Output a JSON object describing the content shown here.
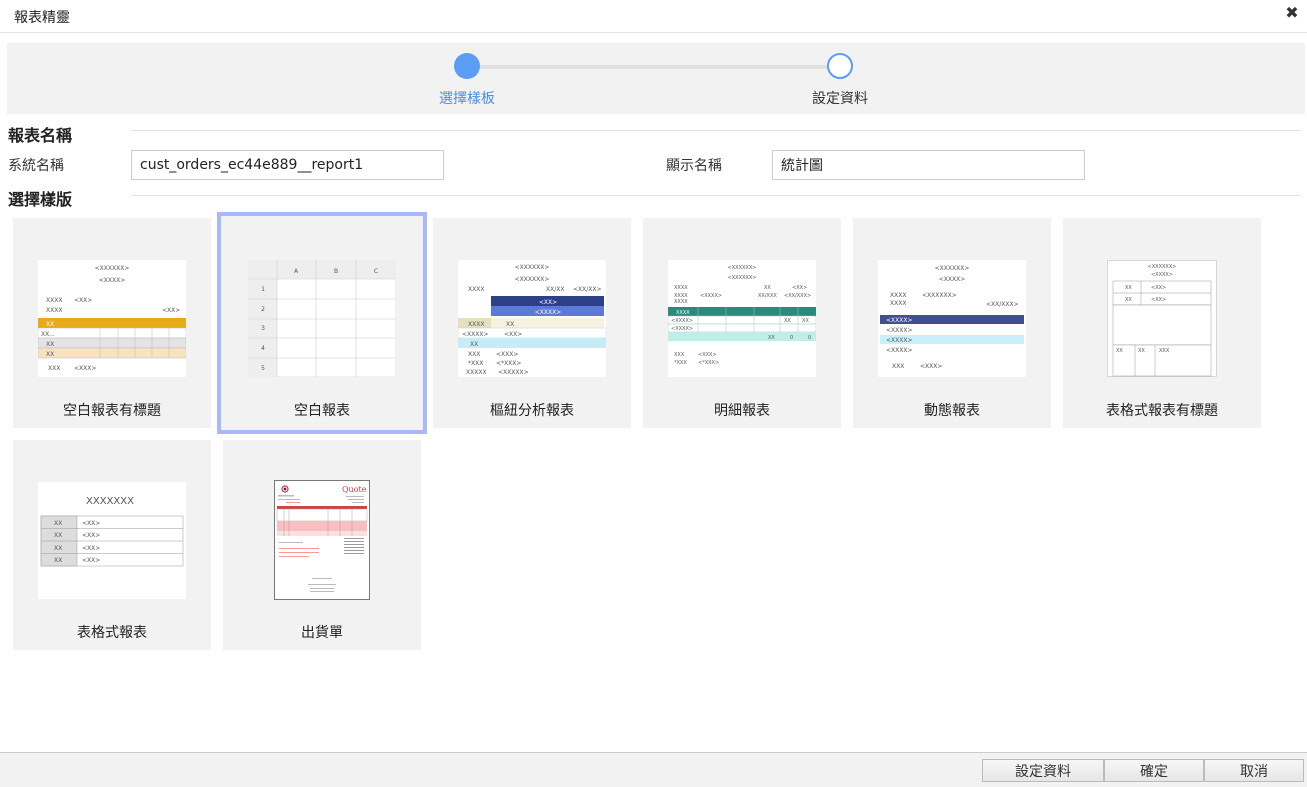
{
  "window": {
    "title": "報表精靈"
  },
  "steps": [
    {
      "label": "選擇樣板",
      "active": true
    },
    {
      "label": "設定資料",
      "active": false
    }
  ],
  "report_name": {
    "section_title": "報表名稱",
    "system_name_label": "系統名稱",
    "system_name_value": "cust_orders_ec44e889__report1",
    "display_name_label": "顯示名稱",
    "display_name_value": "統計圖"
  },
  "template_section": {
    "section_title": "選擇樣版",
    "templates": [
      {
        "label": "空白報表有標題"
      },
      {
        "label": "空白報表",
        "selected": true
      },
      {
        "label": "樞紐分析報表"
      },
      {
        "label": "明細報表"
      },
      {
        "label": "動態報表"
      },
      {
        "label": "表格式報表有標題"
      },
      {
        "label": "表格式報表"
      },
      {
        "label": "出貨單"
      }
    ]
  },
  "thumbs": {
    "blank_titled": {
      "t1": "<XXXXXX>",
      "t2": "<XXXX>",
      "a": "XXXX",
      "b": "<XX>",
      "c": "XXXX",
      "d": "<XX>",
      "band": "XX",
      "r1": "XX...",
      "r2": "XX",
      "r3": "XX",
      "f1": "XXX",
      "f2": "<XXX>"
    },
    "blank": {
      "cols": [
        "A",
        "B",
        "C"
      ],
      "rows": [
        "1",
        "2",
        "3",
        "4",
        "5"
      ]
    },
    "pivot": {
      "t1": "<XXXXXX>",
      "t2": "<XXXXXX>",
      "a": "XXXX",
      "b": "XX/XX",
      "c": "<XX/XX>",
      "h1": "<XX>",
      "h2": "<XXXX>",
      "r1": "XXXX",
      "r1b": "XX",
      "r2": "<XXXX>",
      "r2b": "<XX>",
      "r3": "XX",
      "f1": "XXX",
      "f2": "<XXX>",
      "f3": "*XXX",
      "f4": "<*XXX>",
      "f5": "XXXXX",
      "f6": "<XXXXX>"
    },
    "detail": {
      "t1": "<XXXXXX>",
      "t2": "<XXXXXX>",
      "a": "XXXX",
      "b": "XX",
      "c": "<XX>",
      "d": "XXXX",
      "e": "<XXXX>",
      "f": "XX/XXX",
      "g": "<XX/XXX>",
      "h": "XXXX",
      "hd": "XXXX",
      "r": "<XXXX>",
      "cell": "XX",
      "total": "XX",
      "zero": "0",
      "f1": "XXX",
      "f2": "<XXX>",
      "f3": "*XXX",
      "f4": "<*XXX>"
    },
    "dynamic": {
      "t1": "<XXXXXX>",
      "t2": "<XXXX>",
      "a": "XXXX",
      "b": "<XXXXXX>",
      "c": "XXXX",
      "d": "<XX/XXX>",
      "band": "<XXXX>",
      "r1": "<XXXX>",
      "r2": "<XXXX>",
      "r3": "<XXXX>",
      "f1": "XXX",
      "f2": "<XXX>"
    },
    "table_titled": {
      "t1": "<XXXXXX>",
      "t2": "<XXXX>",
      "k1": "XX",
      "v1": "<XX>",
      "k2": "XX",
      "v2": "<XX>",
      "b1": "XX",
      "b2": "XX",
      "b3": "XXX"
    },
    "table": {
      "title": "XXXXXXX",
      "key": "XX",
      "val": "<XX>"
    },
    "shipping": {
      "brand": "Quote"
    }
  },
  "footer": {
    "set_data_label": "設定資料",
    "ok_label": "確定",
    "cancel_label": "取消"
  },
  "colors": {
    "accent": "#5b9cf5",
    "selected_border": "#a8b9fb"
  }
}
